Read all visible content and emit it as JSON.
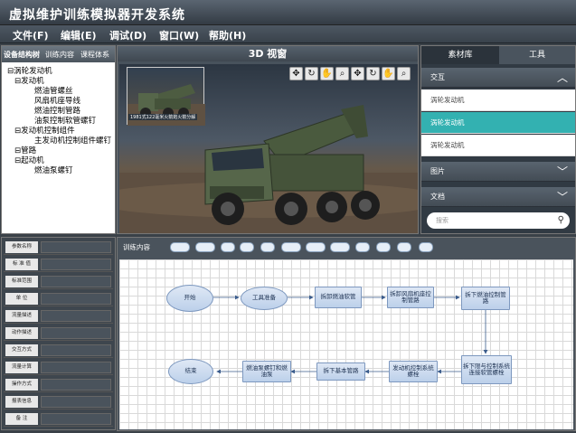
{
  "app": {
    "title": "虚拟维护训练模拟器开发系统"
  },
  "menu": [
    "文件(F)",
    "编辑(E)",
    "调试(D)",
    "窗口(W)",
    "帮助(H)"
  ],
  "left_tabs": [
    "设备结构树",
    "训练内容",
    "课程体系"
  ],
  "tree": [
    "⊟涡轮发动机",
    "⊟发动机",
    "燃油管螺丝",
    "风扇机座导线",
    "燃油控制管路",
    "油泵控制软管螺钉",
    "⊟发动机控制组件",
    "主发动机控制组件螺钉",
    "⊟管路",
    "⊟起动机",
    "燃油泵螺钉"
  ],
  "view3d": {
    "title": "3D 视窗",
    "thumb_caption": "1981式122毫米火箭炮火箭分解",
    "tools": [
      "pan-icon",
      "rotate-icon",
      "hand-icon",
      "zoom-icon",
      "pan-icon",
      "rotate-icon",
      "hand-icon",
      "zoom-icon"
    ]
  },
  "library": {
    "tabs": [
      "素材库",
      "工具"
    ],
    "sections": {
      "interaction": "交互",
      "images": "图片",
      "docs": "文档"
    },
    "items": [
      "涡轮发动机",
      "涡轮发动机",
      "涡轮发动机"
    ],
    "selected_index": 1,
    "search_placeholder": "搜索"
  },
  "params": [
    "参数名称",
    "标 准 值",
    "标准范围",
    "单 位",
    "流量描述",
    "动作描述",
    "交互方式",
    "流量计算",
    "操作方式",
    "报表信息",
    "备 注"
  ],
  "training": {
    "title": "训练内容",
    "toolbar_count": 12,
    "flow": {
      "start": "开始",
      "prep": "工具准备",
      "step1": "拆卸燃油软管",
      "step2": "拆卸风扇机座控制管路",
      "step3": "拆下燃油控制管路",
      "step4": "拆下限与控制系统连接软管螺栓",
      "step5": "发动机控制系统螺栓",
      "step6": "拆下基本管路",
      "step7": "燃油泵螺钉和燃油泵",
      "end": "结束"
    }
  },
  "colors": {
    "accent": "#33b1b1",
    "node_fill": "#c9d9ef",
    "node_border": "#7d98bf"
  }
}
